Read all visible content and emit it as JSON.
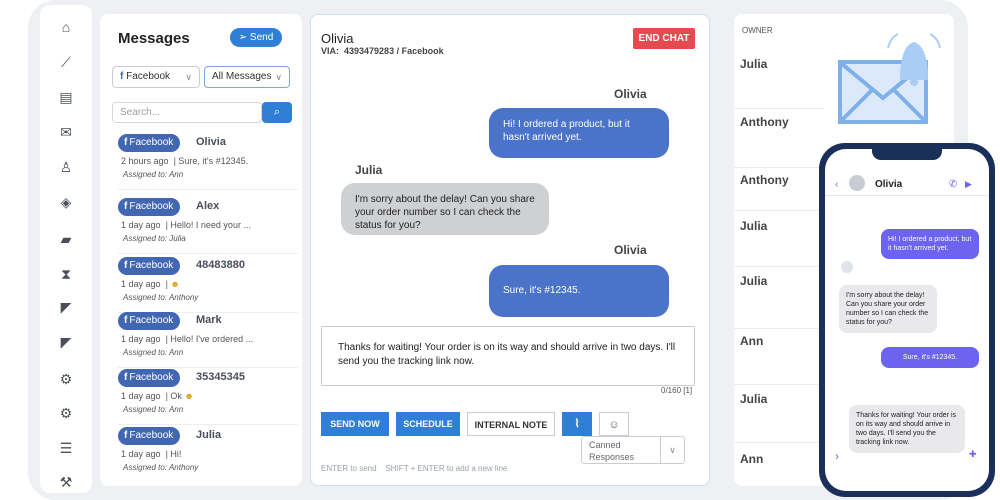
{
  "colors": {
    "accent": "#2f7fd6",
    "facebook": "#4267b2",
    "danger": "#e44a4f",
    "bubble_agent": "#4a73c9",
    "bubble_user": "#cfd0d2",
    "phone_bubble": "#6c63f0"
  },
  "rail": {
    "icons": [
      "home-icon",
      "brush-icon",
      "chat-icon",
      "mail-icon",
      "user-icon",
      "tag-icon",
      "folder-icon",
      "hourglass-icon",
      "megaphone-icon",
      "megaphone-icon",
      "gear-icon",
      "gear-icon",
      "list-icon",
      "wrench-icon"
    ]
  },
  "messages": {
    "title": "Messages",
    "send_label": "Send",
    "channel_filter": "Facebook",
    "message_filter": "All Messages",
    "search_placeholder": "Search...",
    "conversations": [
      {
        "channel": "Facebook",
        "name": "Olivia",
        "time": "2 hours ago",
        "preview": "| Sure, it's #12345.",
        "assigned": "Assigned to: Ann"
      },
      {
        "channel": "Facebook",
        "name": "Alex",
        "time": "1 day ago",
        "preview": "| Hello! I need your ...",
        "assigned": "Assigned to: Julia"
      },
      {
        "channel": "Facebook",
        "name": "48483880",
        "time": "1 day ago",
        "preview": "|",
        "assigned": "Assigned to: Anthony"
      },
      {
        "channel": "Facebook",
        "name": "Mark",
        "time": "1 day ago",
        "preview": "| Hello! I've ordered ...",
        "assigned": "Assigned to: Ann"
      },
      {
        "channel": "Facebook",
        "name": "35345345",
        "time": "1 day ago",
        "preview": "| Ok",
        "assigned": "Assigned to: Ann"
      },
      {
        "channel": "Facebook",
        "name": "Julia",
        "time": "1 day ago",
        "preview": "| Hi!",
        "assigned": "Assigned to: Anthony"
      }
    ]
  },
  "chat": {
    "contact": "Olivia",
    "via_label": "VIA:",
    "via_value": "4393479283 / Facebook",
    "end_label": "END CHAT",
    "messages": [
      {
        "speaker": "Olivia",
        "text": "Hi! I ordered a product, but it hasn't arrived yet."
      },
      {
        "speaker": "Julia",
        "text": "I'm sorry about the delay! Can you share your order number so I can check the status for you?"
      },
      {
        "speaker": "Olivia",
        "text": "Sure, it's #12345."
      }
    ],
    "draft": "Thanks for waiting! Your order is on its way and should arrive in two days. I'll send you the tracking link now.",
    "counter": "0/160 [1]",
    "send_now": "SEND NOW",
    "schedule": "SCHEDULE",
    "internal_note": "INTERNAL NOTE",
    "canned": "Canned Responses",
    "hint": "ENTER to send    SHIFT + ENTER to add a new line"
  },
  "owners": {
    "header": "OWNER",
    "names": [
      "Julia",
      "Anthony",
      "Anthony",
      "Julia",
      "Julia",
      "Ann",
      "Julia",
      "Ann"
    ]
  },
  "phone": {
    "contact": "Olivia",
    "messages": [
      "Hi! I ordered a product, but it hasn't arrived yet.",
      "I'm sorry about the delay! Can you share your order number so I can check the status for you?",
      "Sure, it's #12345.",
      "Thanks for waiting! Your order is on its way and should arrive in two days. I'll send you the tracking link now."
    ]
  }
}
